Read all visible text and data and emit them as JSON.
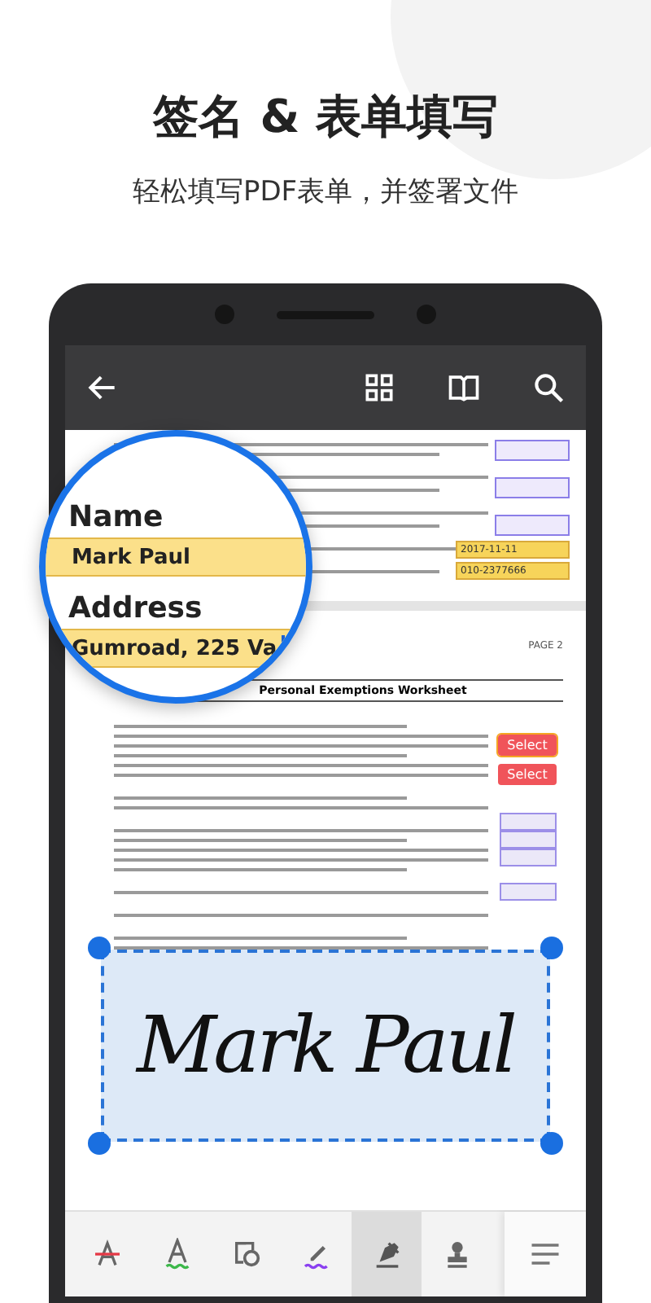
{
  "headline": "签名 & 表单填写",
  "subheadline": "轻松填写PDF表单，并签署文件",
  "magnifier": {
    "fields": [
      {
        "label": "Name",
        "value": "Mark Paul",
        "focused": false
      },
      {
        "label": "Address",
        "value": "Gumroad, 225 Va",
        "focused": true
      }
    ]
  },
  "document": {
    "page_1": {
      "dates": [
        "2017-11-11",
        "010-2377666"
      ]
    },
    "page_2": {
      "page_number": "PAGE 2",
      "title": "Personal Exemptions Worksheet",
      "buttons": [
        {
          "label": "Select",
          "selected": true
        },
        {
          "label": "Select",
          "selected": false
        }
      ]
    },
    "signature": {
      "text": "Mark Paul"
    }
  },
  "toolbar": {
    "tools": [
      {
        "kind": "strikethrough",
        "selected": false
      },
      {
        "kind": "underline",
        "selected": false
      },
      {
        "kind": "shape",
        "selected": false
      },
      {
        "kind": "pen",
        "selected": false
      },
      {
        "kind": "signature",
        "selected": true
      },
      {
        "kind": "stamp",
        "selected": false
      }
    ]
  }
}
